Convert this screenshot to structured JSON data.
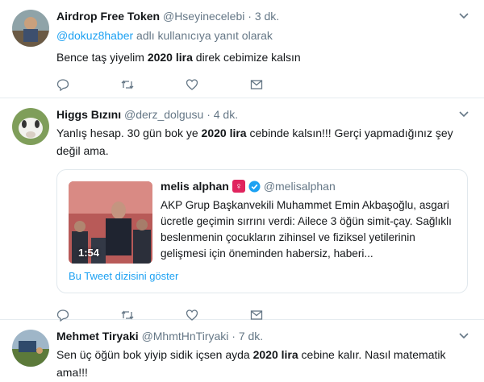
{
  "tweets": [
    {
      "name": "Airdrop Free Token",
      "handle": "@Hseyinecelebi",
      "dot": "·",
      "time": "3 dk.",
      "reply_mention": "@dokuz8haber",
      "reply_suffix": " adlı kullanıcıya yanıt olarak",
      "text_before": "Bence taş yiyelim ",
      "text_bold": "2020 lira",
      "text_after": " direk cebimize kalsın"
    },
    {
      "name": "Higgs Bızını",
      "handle": "@derz_dolgusu",
      "dot": "·",
      "time": "4 dk.",
      "text_before": "Yanlış hesap. 30 gün bok ye ",
      "text_bold": "2020 lira",
      "text_after": " cebinde kalsın!!! Gerçi yapmadığınız şey değil ama.",
      "quote": {
        "name": "melis alphan",
        "emoji": "♀",
        "handle": "@melisalphan",
        "duration": "1:54",
        "text": "AKP Grup Başkanvekili Muhammet Emin Akbaşoğlu, asgari ücretle geçimin sırrını verdi: Ailece 3 öğün simit-çay. Sağlıklı beslenmenin çocukların zihinsel ve fiziksel yetilerinin gelişmesi için öneminden habersiz, haberi...",
        "show_thread": "Bu Tweet dizisini göster"
      }
    },
    {
      "name": "Mehmet Tiryaki",
      "handle": "@MhmtHnTiryaki",
      "dot": "·",
      "time": "7 dk.",
      "text_before": "Sen üç öğün bok yiyip sidik içsen ayda ",
      "text_bold": "2020 lira",
      "text_after": " cebine kalır. Nasıl matematik ama!!!"
    }
  ],
  "icons": [
    "reply-icon",
    "retweet-icon",
    "like-icon",
    "message-icon",
    "caret-down-icon",
    "verified-icon"
  ],
  "colors": {
    "link": "#1da1f2",
    "muted": "#657786",
    "border": "#e6ecf0"
  }
}
